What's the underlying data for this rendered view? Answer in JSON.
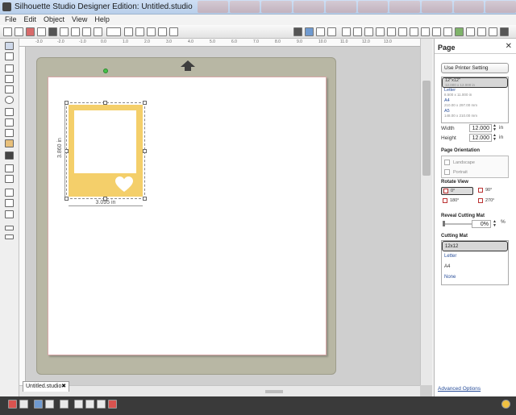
{
  "window": {
    "title": "Silhouette Studio Designer Edition: Untitled.studio"
  },
  "menu": [
    "File",
    "Edit",
    "Object",
    "View",
    "Help"
  ],
  "doc_tab": {
    "label": "Untitled.studio"
  },
  "ruler": {
    "top_labels": [
      "-3.0",
      "-2.0",
      "-1.0",
      "0.0",
      "1.0",
      "2.0",
      "3.0",
      "4.0",
      "5.0",
      "6.0",
      "7.0",
      "8.0",
      "9.0",
      "10.0",
      "11.0",
      "12.0",
      "13.0"
    ]
  },
  "shape": {
    "width_label": "3.095 in",
    "height_label": "3.860 in",
    "fill_color": "#f4cf6a"
  },
  "panel": {
    "title": "Page",
    "printer_button": "Use Printer Setting",
    "sizes": [
      {
        "name": "12\"x12\"",
        "dims": "12.000 x 12.000 in",
        "selected": true
      },
      {
        "name": "Letter",
        "dims": "8.500 x 11.000 in",
        "selected": false
      },
      {
        "name": "A4",
        "dims": "210.00 x 297.00 mm",
        "selected": false
      },
      {
        "name": "A5",
        "dims": "148.00 x 210.00 mm",
        "selected": false
      }
    ],
    "width_label": "Width",
    "width_value": "12.000",
    "height_label": "Height",
    "height_value": "12.000",
    "unit": "in",
    "orientation_label": "Page Orientation",
    "orientation_options": [
      "Landscape",
      "Portrait"
    ],
    "rotate_label": "Rotate View",
    "rotate_options": [
      "0°",
      "90°",
      "180°",
      "270°"
    ],
    "reveal_label": "Reveal Cutting Mat",
    "reveal_value": "0%",
    "reveal_unit": "%",
    "mat_label": "Cutting Mat",
    "mat_options": [
      "12x12",
      "Letter",
      "A4",
      "None"
    ],
    "advanced_link": "Advanced Options"
  },
  "colors": {
    "mat": "#b8b7a4",
    "paper_border": "#d8a8a8",
    "shape": "#f4cf6a",
    "accent_link": "#2a4f9a"
  }
}
